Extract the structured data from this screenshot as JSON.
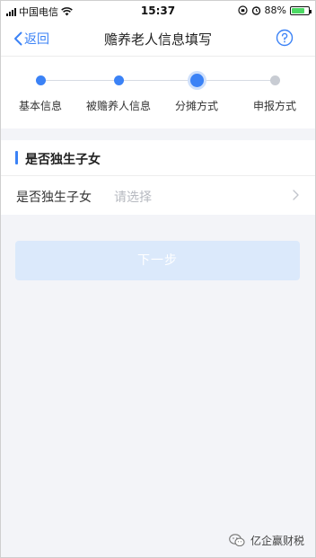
{
  "status_bar": {
    "carrier": "中国电信",
    "time": "15:37",
    "battery": "88%"
  },
  "nav": {
    "back_label": "返回",
    "title": "赡养老人信息填写"
  },
  "steps": [
    {
      "label": "基本信息",
      "state": "done"
    },
    {
      "label": "被赡养人信息",
      "state": "done"
    },
    {
      "label": "分摊方式",
      "state": "current"
    },
    {
      "label": "申报方式",
      "state": "pending"
    }
  ],
  "section": {
    "title": "是否独生子女",
    "field": {
      "label": "是否独生子女",
      "placeholder": "请选择"
    }
  },
  "next_button": {
    "label": "下一步"
  },
  "watermark": {
    "text": "亿企赢财税"
  },
  "colors": {
    "accent": "#3b82f6",
    "button_disabled": "#dbe9fb",
    "background": "#f3f4f8"
  }
}
